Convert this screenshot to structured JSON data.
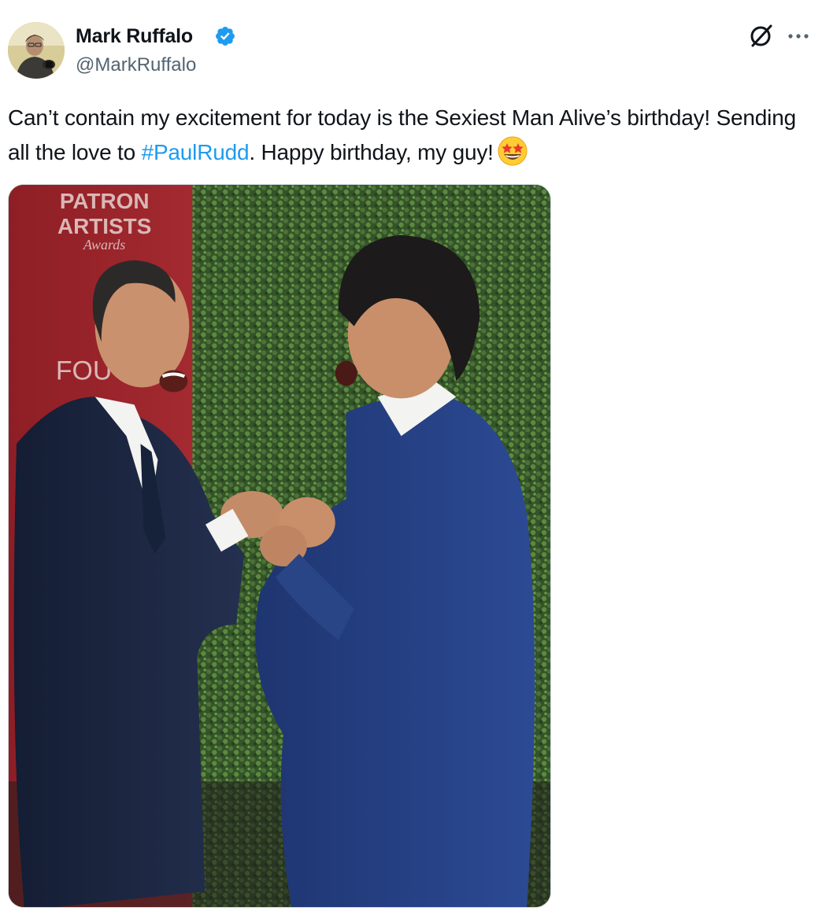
{
  "author": {
    "name": "Mark Ruffalo",
    "handle": "@MarkRuffalo",
    "verified": true,
    "avatar_icon": "avatar-photo"
  },
  "actions": {
    "grok_icon": "grok-icon",
    "more_icon": "more-icon"
  },
  "tweet": {
    "text_before": "Can’t contain my excitement for today is the Sexiest Man Alive’s birthday! Sending all the love to ",
    "hashtag": "#PaulRudd",
    "text_after": ". Happy birthday, my guy!",
    "emoji": "star-struck-emoji"
  },
  "media": {
    "type": "photo",
    "backdrop_sign": {
      "line1": "PATRON",
      "line2": "ARTISTS",
      "line3": "Awards",
      "partial": "FOU"
    }
  },
  "colors": {
    "link": "#1d9bf0",
    "verified": "#1d9bf0",
    "secondary_text": "#536471"
  }
}
